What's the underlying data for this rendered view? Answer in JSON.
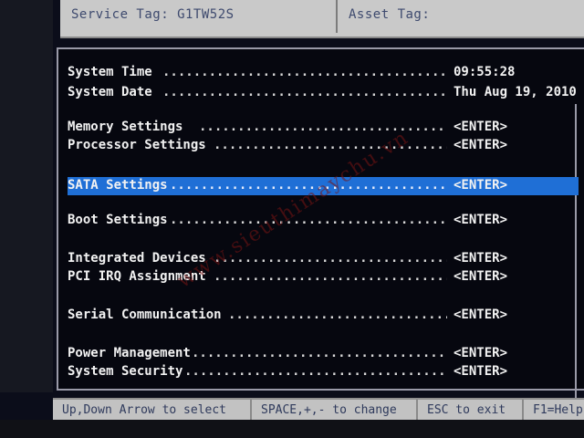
{
  "header": {
    "service_tag": "Service Tag: G1TW52S",
    "asset_tag": "Asset Tag:"
  },
  "menu": {
    "items": [
      {
        "label": "System Time",
        "value": "09:55:28"
      },
      {
        "label": "System Date",
        "value": "Thu Aug 19, 2010"
      },
      {
        "label": "Memory Settings",
        "value": "<ENTER>"
      },
      {
        "label": "Processor Settings",
        "value": "<ENTER>"
      },
      {
        "label": "SATA Settings",
        "value": "<ENTER>"
      },
      {
        "label": "Boot Settings",
        "value": "<ENTER>"
      },
      {
        "label": "Integrated Devices",
        "value": "<ENTER>"
      },
      {
        "label": "PCI IRQ Assignment",
        "value": "<ENTER>"
      },
      {
        "label": "Serial Communication",
        "value": "<ENTER>"
      },
      {
        "label": "Power Management",
        "value": "<ENTER>"
      },
      {
        "label": "System Security",
        "value": "<ENTER>"
      }
    ],
    "selected": "SATA Settings"
  },
  "watermark": "www.sieuthimaychu.vn",
  "help": {
    "nav": "Up,Down Arrow to select",
    "change": "SPACE,+,- to change",
    "exit": "ESC to exit",
    "help": "F1=Help"
  },
  "colors": {
    "selection": "#1f6fd6",
    "background": "#06070f",
    "panel": "#c9c9c9"
  }
}
